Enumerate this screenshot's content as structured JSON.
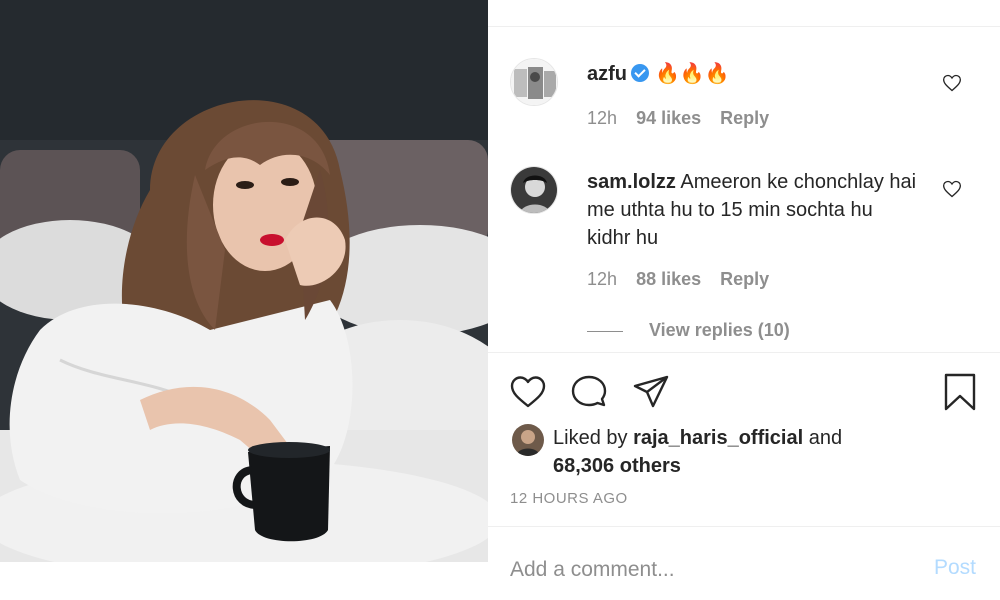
{
  "post": {
    "comments": [
      {
        "username": "azfu",
        "verified": true,
        "text": "🔥🔥🔥",
        "time": "12h",
        "likes": "94 likes",
        "reply": "Reply"
      },
      {
        "username": "sam.lolzz",
        "verified": false,
        "text": "Ameeron ke chonchlay hai me uthta hu to 15 min sochta hu kidhr hu",
        "time": "12h",
        "likes": "88 likes",
        "reply": "Reply"
      }
    ],
    "view_replies": "View replies (10)",
    "liked_by_prefix": "Liked by",
    "liked_by_user": "raja_haris_official",
    "liked_by_and": "and",
    "liked_by_others": "68,306 others",
    "time_ago": "12 HOURS AGO",
    "comment_placeholder": "Add a comment...",
    "post_label": "Post"
  },
  "colors": {
    "verified": "#3897f0",
    "muted": "#8e8e8e",
    "post_disabled": "#b3dbff",
    "text": "#262626"
  },
  "icons": {
    "like": "heart-icon",
    "comment": "comment-icon",
    "share": "share-icon",
    "save": "bookmark-icon"
  }
}
